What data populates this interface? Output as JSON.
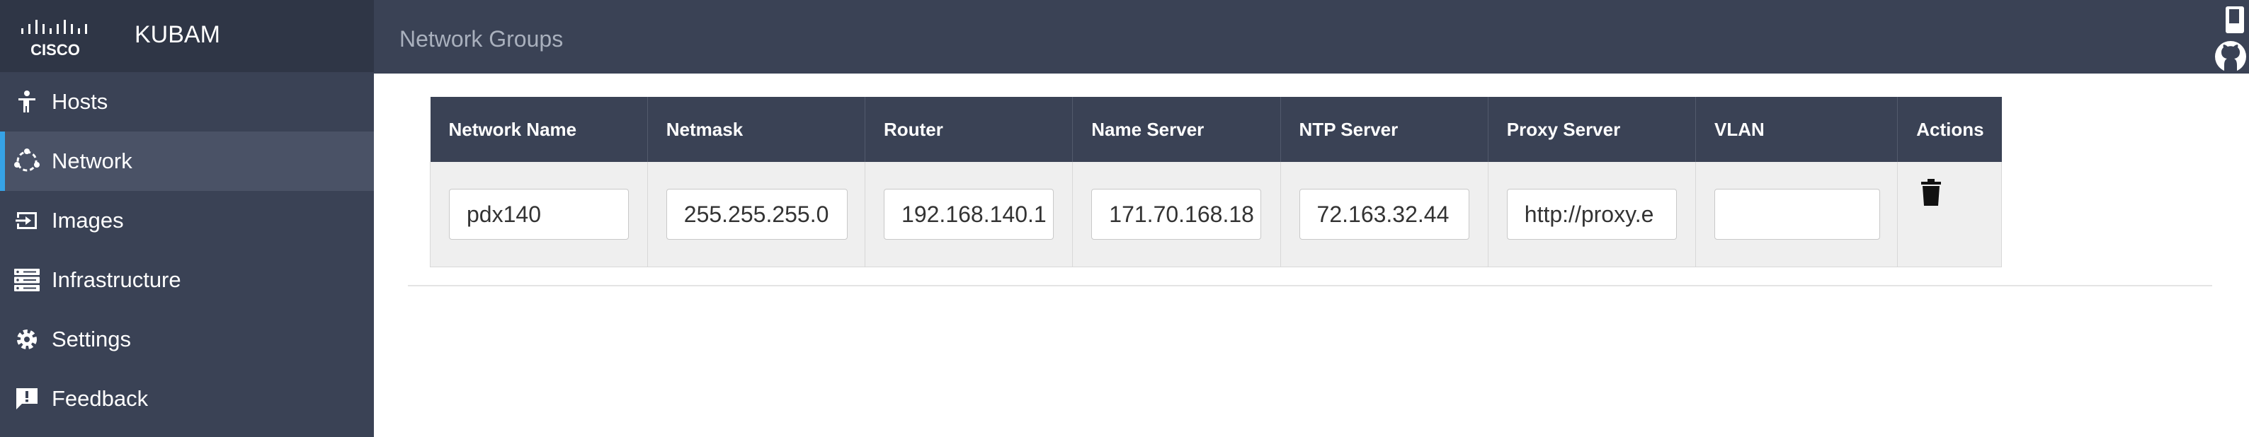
{
  "app": {
    "name": "KUBAM",
    "logo_text": "CISCO"
  },
  "sidebar": {
    "items": [
      {
        "label": "Hosts",
        "icon": "hosts-icon",
        "active": false
      },
      {
        "label": "Network",
        "icon": "network-icon",
        "active": true
      },
      {
        "label": "Images",
        "icon": "images-icon",
        "active": false
      },
      {
        "label": "Infrastructure",
        "icon": "infrastructure-icon",
        "active": false
      },
      {
        "label": "Settings",
        "icon": "gear-icon",
        "active": false
      },
      {
        "label": "Feedback",
        "icon": "feedback-icon",
        "active": false
      }
    ]
  },
  "header": {
    "title": "Network Groups"
  },
  "table": {
    "columns": [
      "Network Name",
      "Netmask",
      "Router",
      "Name Server",
      "NTP Server",
      "Proxy Server",
      "VLAN",
      "Actions"
    ],
    "rows": [
      {
        "network_name": "pdx140",
        "netmask": "255.255.255.0",
        "router": "192.168.140.1",
        "name_server": "171.70.168.18",
        "ntp_server": "72.163.32.44",
        "proxy_server": "http://proxy.e",
        "vlan": ""
      }
    ]
  },
  "colors": {
    "sidebar": "#3a4255",
    "accent": "#36a3e7",
    "row_bg": "#efefef"
  }
}
